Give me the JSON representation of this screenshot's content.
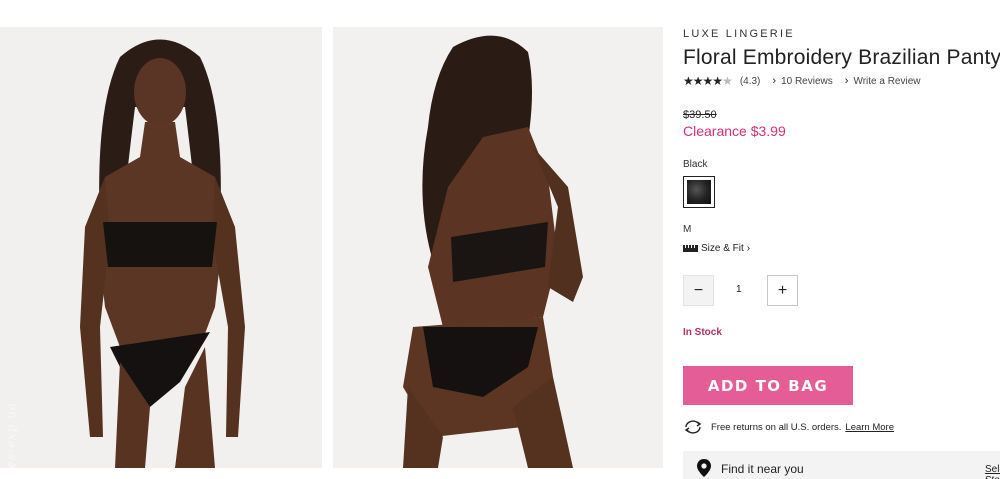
{
  "product": {
    "brand": "LUXE LINGERIE",
    "title": "Floral Embroidery Brazilian Panty",
    "rating": {
      "stars": 4.3,
      "value_text": "(4.3)",
      "reviews_link": "10 Reviews",
      "write_link": "Write a Review"
    },
    "price": {
      "original": "$39.50",
      "sale": "Clearance $3.99"
    },
    "color": {
      "label": "Black",
      "swatch_color": "#222222"
    },
    "size": {
      "label": "M",
      "size_fit_link": "Size & Fit"
    },
    "quantity": {
      "value": "1",
      "minus": "−",
      "plus": "+"
    },
    "stock_status": "In Stock",
    "add_to_bag": "ADD TO BAG",
    "returns": {
      "text": "Free returns on all U.S. orders.",
      "link": "Learn More"
    },
    "store": {
      "label": "Find it near you",
      "link": "Select Store"
    }
  },
  "watermark": "ladies-exp.ua",
  "colors": {
    "accent_pink": "#e55d96",
    "sale_pink": "#d62f7b",
    "stock_red": "#b03060"
  },
  "icons": {
    "star": "star-icon",
    "chevron": "chevron-right-icon",
    "ruler": "ruler-icon",
    "returns": "returns-icon",
    "pin": "location-pin-icon"
  }
}
